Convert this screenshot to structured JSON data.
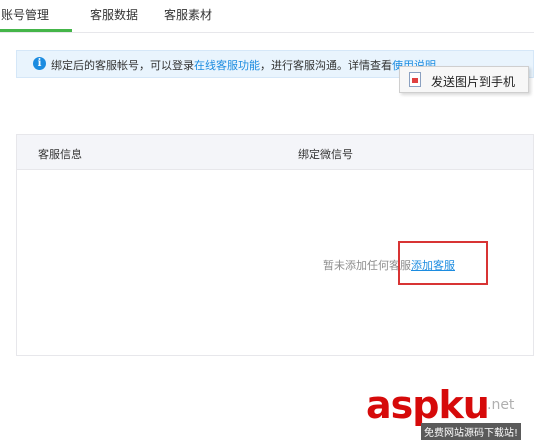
{
  "tabs": [
    {
      "label": "账号管理",
      "active": true
    },
    {
      "label": "客服数据",
      "active": false
    },
    {
      "label": "客服素材",
      "active": false
    }
  ],
  "notice": {
    "icon": "info-icon",
    "text_before": "绑定后的客服帐号，可以登录",
    "link1": "在线客服功能",
    "text_middle": "，进行客服沟通。详情查看",
    "link2": "使用说明"
  },
  "context_menu": {
    "icon": "image-file-icon",
    "label": "发送图片到手机"
  },
  "table": {
    "headers": [
      "客服信息",
      "绑定微信号"
    ],
    "empty_text": "暂未添加任何客服",
    "add_link": "添加客服"
  },
  "watermark": {
    "logo": "aspku",
    "net": ".net",
    "caption": "免费网站源码下载站!"
  },
  "colors": {
    "accent_green": "#44b549",
    "link_blue": "#1c8ce0",
    "highlight_red": "#d83434"
  }
}
